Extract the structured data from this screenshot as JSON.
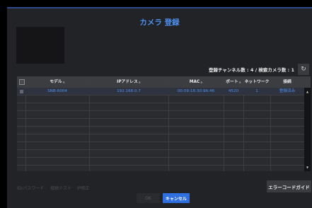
{
  "dialog": {
    "title": "カメラ 登録",
    "counts_text": "登録チャンネル数 : 4 / 検索カメラ数 : 1",
    "refresh_icon": "refresh-icon",
    "accent": "#4d90f0"
  },
  "table": {
    "headers": {
      "model": "モデル",
      "ip": "IPアドレス",
      "mac": "MAC",
      "port": "ポート",
      "network": "ネットワーク",
      "status": "接続"
    },
    "rows": [
      {
        "model": "SNB-6004",
        "ip": "192.168.0.7",
        "mac": "00:09:18:30:9A:46",
        "port": "4520",
        "network": "1",
        "status": "登録済み"
      }
    ]
  },
  "actions": {
    "id_password": "ID/パスワード",
    "connect_test": "接続テスト",
    "ip_change": "IP修正",
    "error_code_guide": "エラーコードガイド"
  },
  "footer": {
    "ok": "OK",
    "cancel": "キャンセル"
  }
}
